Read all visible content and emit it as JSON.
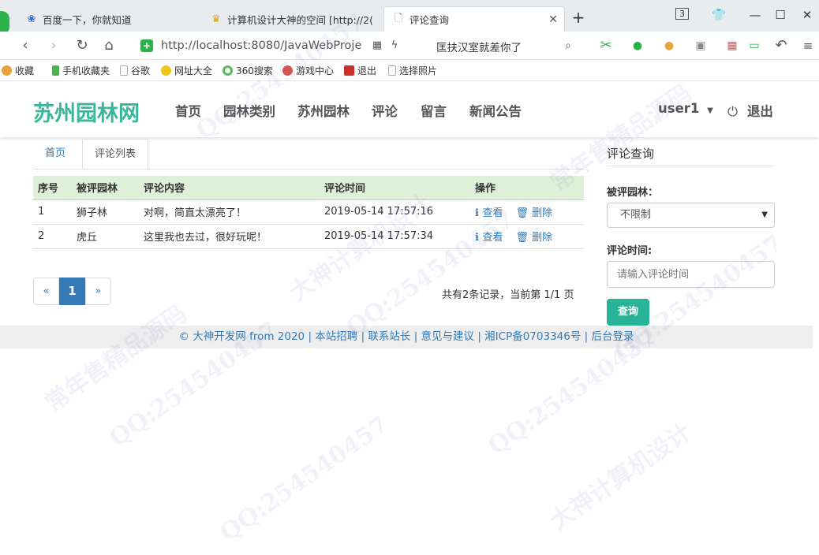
{
  "browser": {
    "tabs": [
      {
        "label": "百度一下，你就知道"
      },
      {
        "label": "计算机设计大神的空间 [http://2("
      },
      {
        "label": "评论查询"
      }
    ],
    "tab_count": "3",
    "url": "http://localhost:8080/JavaWebProje",
    "search_text": "匡扶汉室就差你了",
    "bookmarks": [
      {
        "label": "收藏",
        "color": "#e8a33a"
      },
      {
        "label": "手机收藏夹",
        "color": "#4caf50"
      },
      {
        "label": "谷歌",
        "color": "#bbbbbb"
      },
      {
        "label": "网址大全",
        "color": "#f0c419"
      },
      {
        "label": "360搜索",
        "color": "#5cb85c"
      },
      {
        "label": "游戏中心",
        "color": "#d9534f"
      },
      {
        "label": "退出",
        "color": "#c9302c"
      },
      {
        "label": "选择照片",
        "color": "#bbbbbb"
      }
    ]
  },
  "site": {
    "brand": "苏州园林网",
    "nav": [
      "首页",
      "园林类别",
      "苏州园林",
      "评论",
      "留言",
      "新闻公告"
    ],
    "user": "user1",
    "logout": "退出"
  },
  "breadcrumb_tabs": [
    "首页",
    "评论列表"
  ],
  "table": {
    "headers": [
      "序号",
      "被评园林",
      "评论内容",
      "评论时间",
      "操作"
    ],
    "rows": [
      {
        "no": "1",
        "garden": "狮子林",
        "content": "对啊，简直太漂亮了！",
        "time": "2019-05-14 17:57:16",
        "view": "查看",
        "delete": "删除"
      },
      {
        "no": "2",
        "garden": "虎丘",
        "content": "这里我也去过，很好玩呢！",
        "time": "2019-05-14 17:57:34",
        "view": "查看",
        "delete": "删除"
      }
    ]
  },
  "pagination": {
    "prev": "«",
    "current": "1",
    "next": "»",
    "info": "共有2条记录，当前第 1/1 页"
  },
  "sidebar": {
    "title": "评论查询",
    "garden_label": "被评园林：",
    "garden_value": "不限制",
    "time_label": "评论时间:",
    "time_placeholder": "请输入评论时间",
    "query_button": "查询"
  },
  "footer": "© 大神开发网 from 2020 | 本站招聘 | 联系站长 | 意见与建议 | 湘ICP备0703346号 | 后台登录",
  "watermarks": [
    "常年售精品源码",
    "QQ:254540457",
    "大神计算机设计"
  ]
}
